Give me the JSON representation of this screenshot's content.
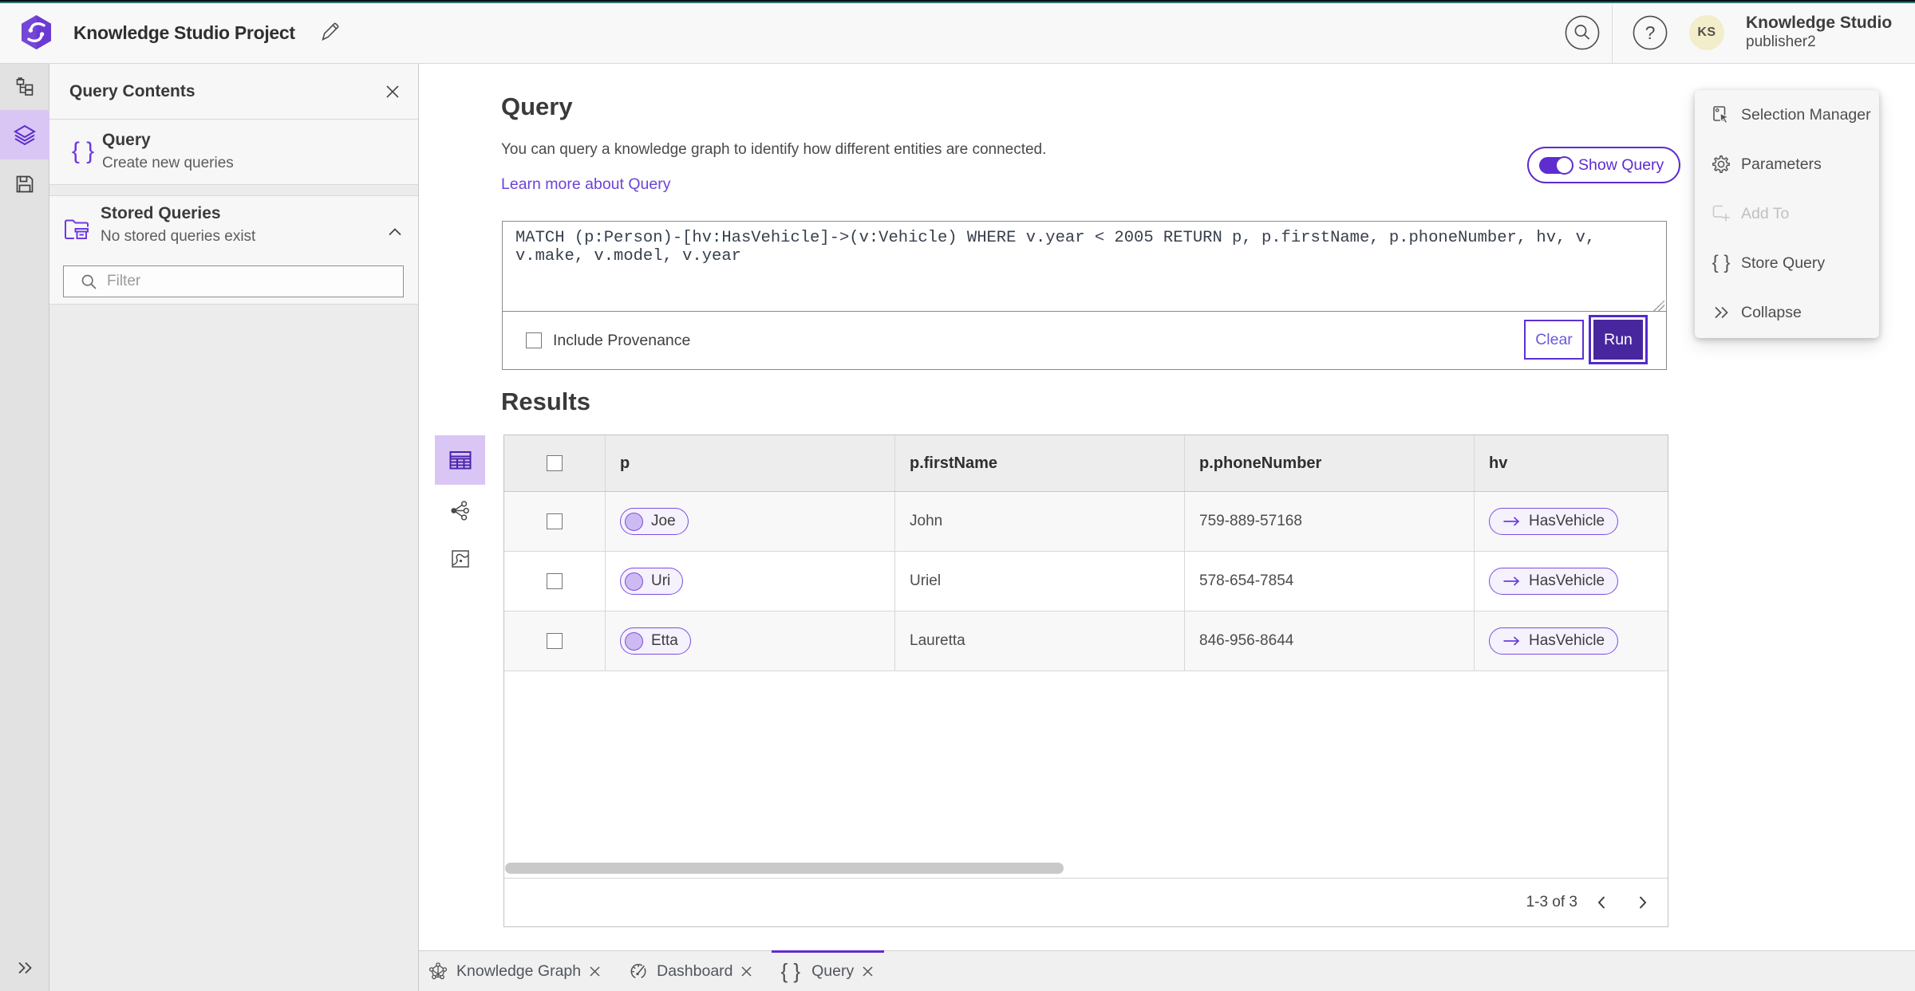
{
  "header": {
    "title": "Knowledge Studio Project",
    "user_name": "Knowledge Studio",
    "user_role": "publisher2",
    "avatar_initials": "KS"
  },
  "panel": {
    "title": "Query Contents",
    "query_item": {
      "title": "Query",
      "subtitle": "Create new queries",
      "icon": "{ }"
    },
    "stored": {
      "title": "Stored Queries",
      "subtitle": "No stored queries exist"
    },
    "filter_placeholder": "Filter"
  },
  "query": {
    "heading": "Query",
    "description": "You can query a knowledge graph to identify how different entities are connected.",
    "learn_more": "Learn more about Query",
    "show_query_label": "Show Query",
    "query_text": "MATCH (p:Person)-[hv:HasVehicle]->(v:Vehicle) WHERE v.year < 2005 RETURN p, p.firstName, p.phoneNumber, hv, v, v.make, v.model, v.year",
    "include_provenance_label": "Include Provenance",
    "clear_label": "Clear",
    "run_label": "Run"
  },
  "results": {
    "heading": "Results",
    "columns": [
      "p",
      "p.firstName",
      "p.phoneNumber",
      "hv"
    ],
    "rows": [
      {
        "p": "Joe",
        "firstName": "John",
        "phoneNumber": "759-889-57168",
        "hv": "HasVehicle"
      },
      {
        "p": "Uri",
        "firstName": "Uriel",
        "phoneNumber": "578-654-7854",
        "hv": "HasVehicle"
      },
      {
        "p": "Etta",
        "firstName": "Lauretta",
        "phoneNumber": "846-956-8644",
        "hv": "HasVehicle"
      }
    ],
    "pagination": "1-3 of 3"
  },
  "right_menu": {
    "items": [
      {
        "label": "Selection Manager",
        "disabled": false
      },
      {
        "label": "Parameters",
        "disabled": false
      },
      {
        "label": "Add To",
        "disabled": true
      },
      {
        "label": "Store Query",
        "disabled": false
      },
      {
        "label": "Collapse",
        "disabled": false
      }
    ]
  },
  "tabs": [
    {
      "label": "Knowledge Graph",
      "active": false
    },
    {
      "label": "Dashboard",
      "active": false
    },
    {
      "label": "Query",
      "active": true
    }
  ],
  "colors": {
    "accent": "#5e2ccf",
    "accent_dark": "#47269e",
    "accent_light_bg": "#d9c6f5",
    "top_stripe_teal": "#2e7277",
    "link": "#6a43d9"
  }
}
